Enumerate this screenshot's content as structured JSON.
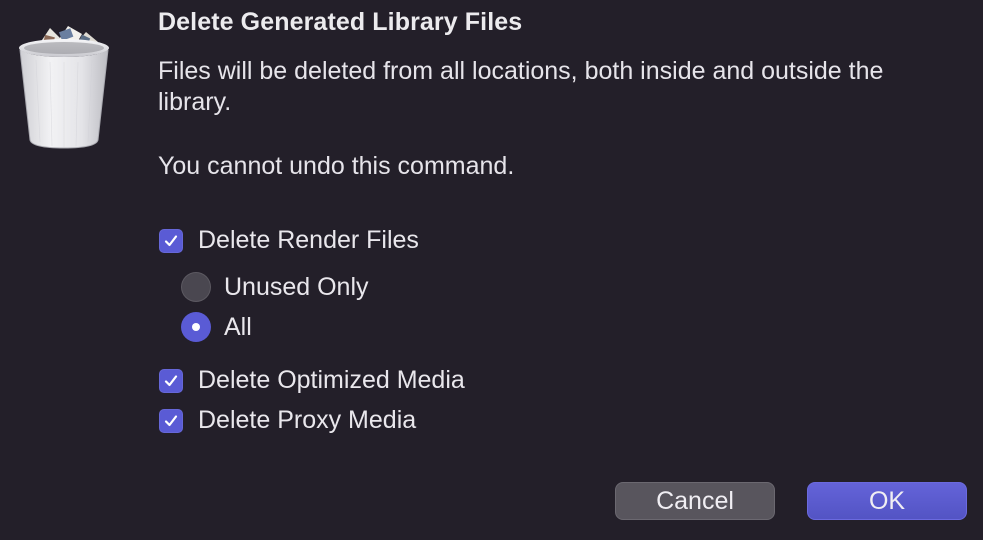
{
  "dialog": {
    "title": "Delete Generated Library Files",
    "message": "Files will be deleted from all locations, both inside and outside the library.",
    "warning": "You cannot undo this command.",
    "options": {
      "render_files": {
        "label": "Delete Render Files",
        "checked": true
      },
      "render_mode": {
        "unused_only": {
          "label": "Unused Only",
          "selected": false
        },
        "all": {
          "label": "All",
          "selected": true
        }
      },
      "optimized_media": {
        "label": "Delete Optimized Media",
        "checked": true
      },
      "proxy_media": {
        "label": "Delete Proxy Media",
        "checked": true
      }
    },
    "buttons": {
      "cancel": "Cancel",
      "ok": "OK"
    },
    "icon": "trash-icon",
    "colors": {
      "background": "#231f29",
      "accent": "#5a5bd5",
      "text": "#e9e7ec"
    }
  }
}
